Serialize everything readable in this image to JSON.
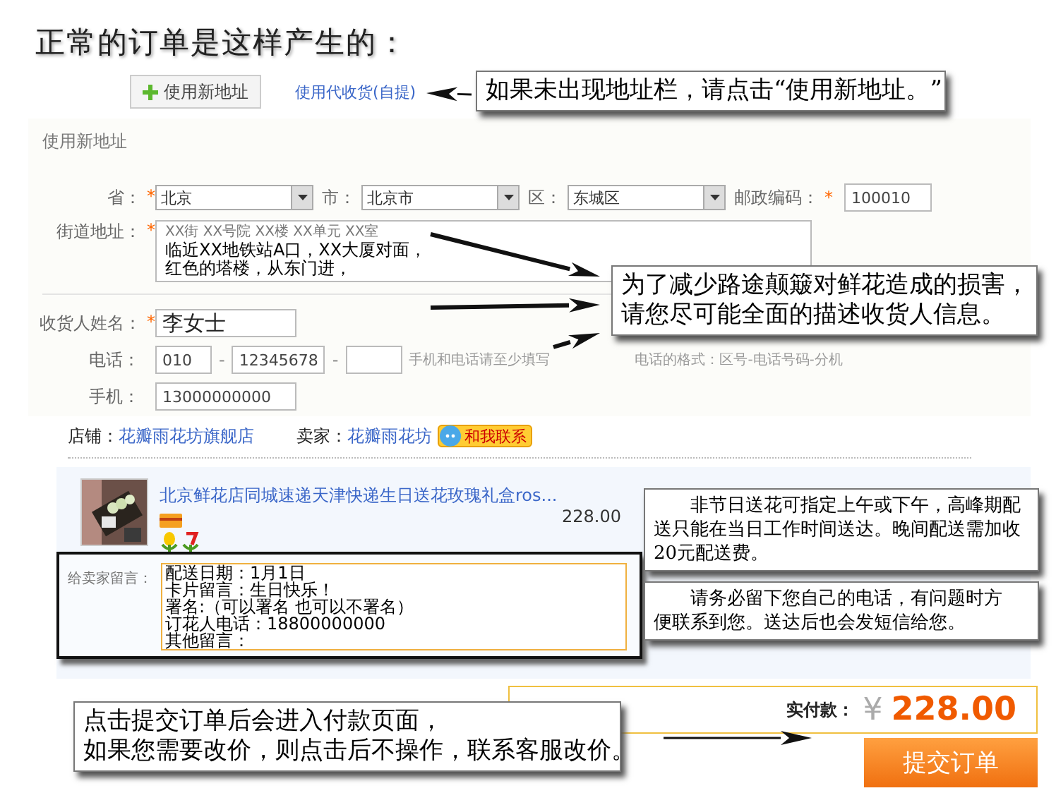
{
  "title": "正常的订单是这样产生的：",
  "address_actions": {
    "new_address_button": "使用新地址",
    "pickup_link": "使用代收货(自提)"
  },
  "address_form": {
    "heading": "使用新地址",
    "region_fields": [
      {
        "label": "省：",
        "required_mark": "*",
        "kind": "select",
        "value": "北京"
      },
      {
        "label": "市：",
        "kind": "select",
        "value": "北京市"
      },
      {
        "label": "区：",
        "kind": "select",
        "value": "东城区"
      },
      {
        "label": "邮政编码：",
        "required_mark": "*",
        "kind": "input",
        "value": "100010"
      }
    ],
    "street": {
      "label": "街道地址：",
      "required_mark": "*",
      "lines": [
        {
          "kind": "hint",
          "text": "XX街 XX号院 XX楼 XX单元 XX室"
        },
        {
          "kind": "typed",
          "text": "临近XX地铁站A口，XX大厦对面，"
        },
        {
          "kind": "typed",
          "text": "红色的塔楼，从东门进，"
        }
      ]
    },
    "recipient": {
      "label": "收货人姓名：",
      "required_mark": "*",
      "value": "李女士"
    },
    "phone": {
      "label": "电话：",
      "area_code": "010",
      "separator": "-",
      "number": "12345678",
      "extension_separator": "-",
      "hint_parts": [
        "手机和电话请至少填写",
        "电话的格式：区号-电话号码-分机"
      ]
    },
    "mobile": {
      "label": "手机：",
      "value": "13000000000"
    }
  },
  "shop": {
    "shop_label": "店铺：",
    "shop_name": "花瓣雨花坊旗舰店",
    "seller_label": "卖家：",
    "seller_name": "花瓣雨花坊",
    "contact_button": "和我联系"
  },
  "item": {
    "kind": "picture",
    "title": "北京鲜花店同城速递天津快递生日送花玫瑰礼盒ros...",
    "price": "228.00"
  },
  "message": {
    "label": "给卖家留言：",
    "lines": [
      "配送日期：1月1日",
      "卡片留言：生日快乐！",
      "署名:（可以署名 也可以不署名）",
      "订花人电话：18800000000",
      "其他留言："
    ]
  },
  "total": {
    "label": "实付款：",
    "currency": "¥",
    "amount": "228.00"
  },
  "submit_button": "提交订单",
  "callouts": [
    {
      "kind": "plain",
      "lines": [
        "如果未出现地址栏，请点击“使用新地址。”"
      ]
    },
    {
      "kind": "plain",
      "lines": [
        "为了减少路途颠簸对鲜花造成的损害，",
        "请您尽可能全面的描述收货人信息。"
      ]
    },
    {
      "kind": "indented",
      "lines": [
        "非节日送花可指定上午或下午，高峰期配",
        "送只能在当日工作时间送达。晚间配送需加收",
        "20元配送费。"
      ]
    },
    {
      "kind": "indented",
      "lines": [
        "请务必留下您自己的电话，有问题时方",
        "便联系到您。送达后也会发短信给您。"
      ]
    },
    {
      "kind": "plain",
      "lines": [
        "点击提交订单后会进入付款页面，",
        "如果您需要改价，则点击后不操作，联系客服改价。"
      ]
    }
  ]
}
